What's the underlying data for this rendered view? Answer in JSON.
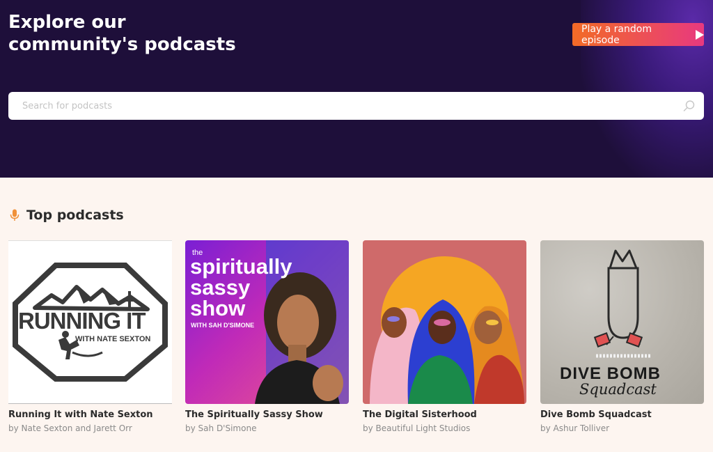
{
  "hero": {
    "title": "Explore our community's podcasts",
    "random_button_label": "Play a random episode"
  },
  "search": {
    "placeholder": "Search for podcasts",
    "value": ""
  },
  "top_podcasts": {
    "heading": "Top podcasts",
    "items": [
      {
        "title": "Running It with Nate Sexton",
        "by": "by",
        "author": "Nate Sexton and Jarett Orr",
        "cover_text": "RUNNING IT",
        "cover_subtext": "WITH NATE SEXTON"
      },
      {
        "title": "The Spiritually Sassy Show",
        "by": "by",
        "author": "Sah D'Simone",
        "cover_text_the": "the",
        "cover_text_1": "spiritually",
        "cover_text_2": "sassy",
        "cover_text_3": "show",
        "cover_subtext": "WITH SAH D'SIMONE"
      },
      {
        "title": "The Digital Sisterhood",
        "by": "by",
        "author": "Beautiful Light Studios"
      },
      {
        "title": "Dive Bomb Squadcast",
        "by": "by",
        "author": "Ashur Tolliver",
        "cover_text": "DIVE BOMB",
        "cover_subtext": "Squadcast"
      }
    ]
  },
  "colors": {
    "hero_bg": "#1e0f3a",
    "button_start": "#f26b26",
    "button_end": "#e8397f",
    "page_bg": "#fdf5f0",
    "accent_mic": "#f0913a"
  },
  "icons": {
    "search": "search-icon",
    "play": "play-icon",
    "section": "microphone-icon"
  }
}
